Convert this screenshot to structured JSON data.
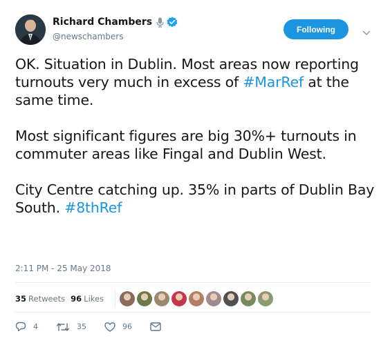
{
  "author": {
    "name": "Richard Chambers",
    "handle": "@newschambers",
    "verified": true
  },
  "follow_button": {
    "label": "Following"
  },
  "tweet": {
    "paragraphs": [
      [
        {
          "text": "OK. Situation in Dublin. Most areas now reporting turnouts very much in excess of "
        },
        {
          "text": "#MarRef",
          "hashtag": true
        },
        {
          "text": " at the same time."
        }
      ],
      [
        {
          "text": "Most significant figures are big 30%+ turnouts in commuter areas like Fingal and Dublin West."
        }
      ],
      [
        {
          "text": "City Centre catching up. 35% in parts of Dublin Bay South. "
        },
        {
          "text": "#8thRef",
          "hashtag": true
        }
      ]
    ],
    "timestamp": "2:11 PM - 25 May 2018"
  },
  "stats": {
    "retweets_count": "35",
    "retweets_label": "Retweets",
    "likes_count": "96",
    "likes_label": "Likes"
  },
  "likers": [
    {
      "icon": "avatar",
      "color": "#8a6a5a"
    },
    {
      "icon": "avatar",
      "color": "#6b7a4a"
    },
    {
      "icon": "avatar",
      "color": "#9c8a70"
    },
    {
      "icon": "avatar",
      "color": "#c7354a"
    },
    {
      "icon": "avatar",
      "color": "#b08060"
    },
    {
      "icon": "avatar",
      "color": "#a08a90"
    },
    {
      "icon": "avatar",
      "color": "#505050"
    },
    {
      "icon": "avatar",
      "color": "#7a8a60"
    },
    {
      "icon": "avatar",
      "color": "#8a9a70"
    }
  ],
  "actions": {
    "replies": "4",
    "retweets": "35",
    "likes": "96"
  },
  "colors": {
    "accent": "#1b95e0",
    "text": "#14171a",
    "muted": "#657786",
    "border": "#e6ecf0"
  }
}
